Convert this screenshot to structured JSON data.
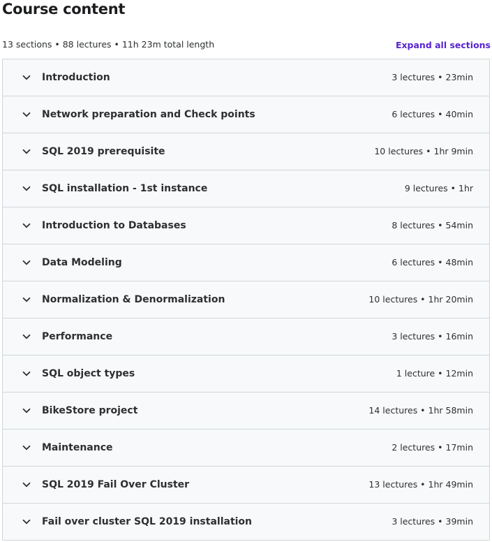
{
  "header": {
    "title": "Course content",
    "summary": "13 sections • 88 lectures • 11h 23m total length",
    "expand_label": "Expand all sections"
  },
  "colors": {
    "accent": "#5624d0",
    "row_background": "#f7f9fa",
    "border": "#d1d7dc"
  },
  "sections": [
    {
      "title": "Introduction",
      "meta": "3 lectures • 23min"
    },
    {
      "title": "Network preparation and Check points",
      "meta": "6 lectures • 40min"
    },
    {
      "title": "SQL 2019 prerequisite",
      "meta": "10 lectures • 1hr 9min"
    },
    {
      "title": "SQL installation - 1st instance",
      "meta": "9 lectures • 1hr"
    },
    {
      "title": "Introduction to Databases",
      "meta": "8 lectures • 54min"
    },
    {
      "title": "Data Modeling",
      "meta": "6 lectures • 48min"
    },
    {
      "title": "Normalization & Denormalization",
      "meta": "10 lectures • 1hr 20min"
    },
    {
      "title": "Performance",
      "meta": "3 lectures • 16min"
    },
    {
      "title": "SQL object types",
      "meta": "1 lecture • 12min"
    },
    {
      "title": "BikeStore project",
      "meta": "14 lectures • 1hr 58min"
    },
    {
      "title": "Maintenance",
      "meta": "2 lectures • 17min"
    },
    {
      "title": "SQL 2019 Fail Over Cluster",
      "meta": "13 lectures • 1hr 49min"
    },
    {
      "title": "Fail over cluster SQL 2019 installation",
      "meta": "3 lectures • 39min"
    }
  ],
  "icons": {
    "section_toggle": "chevron-down-icon"
  }
}
